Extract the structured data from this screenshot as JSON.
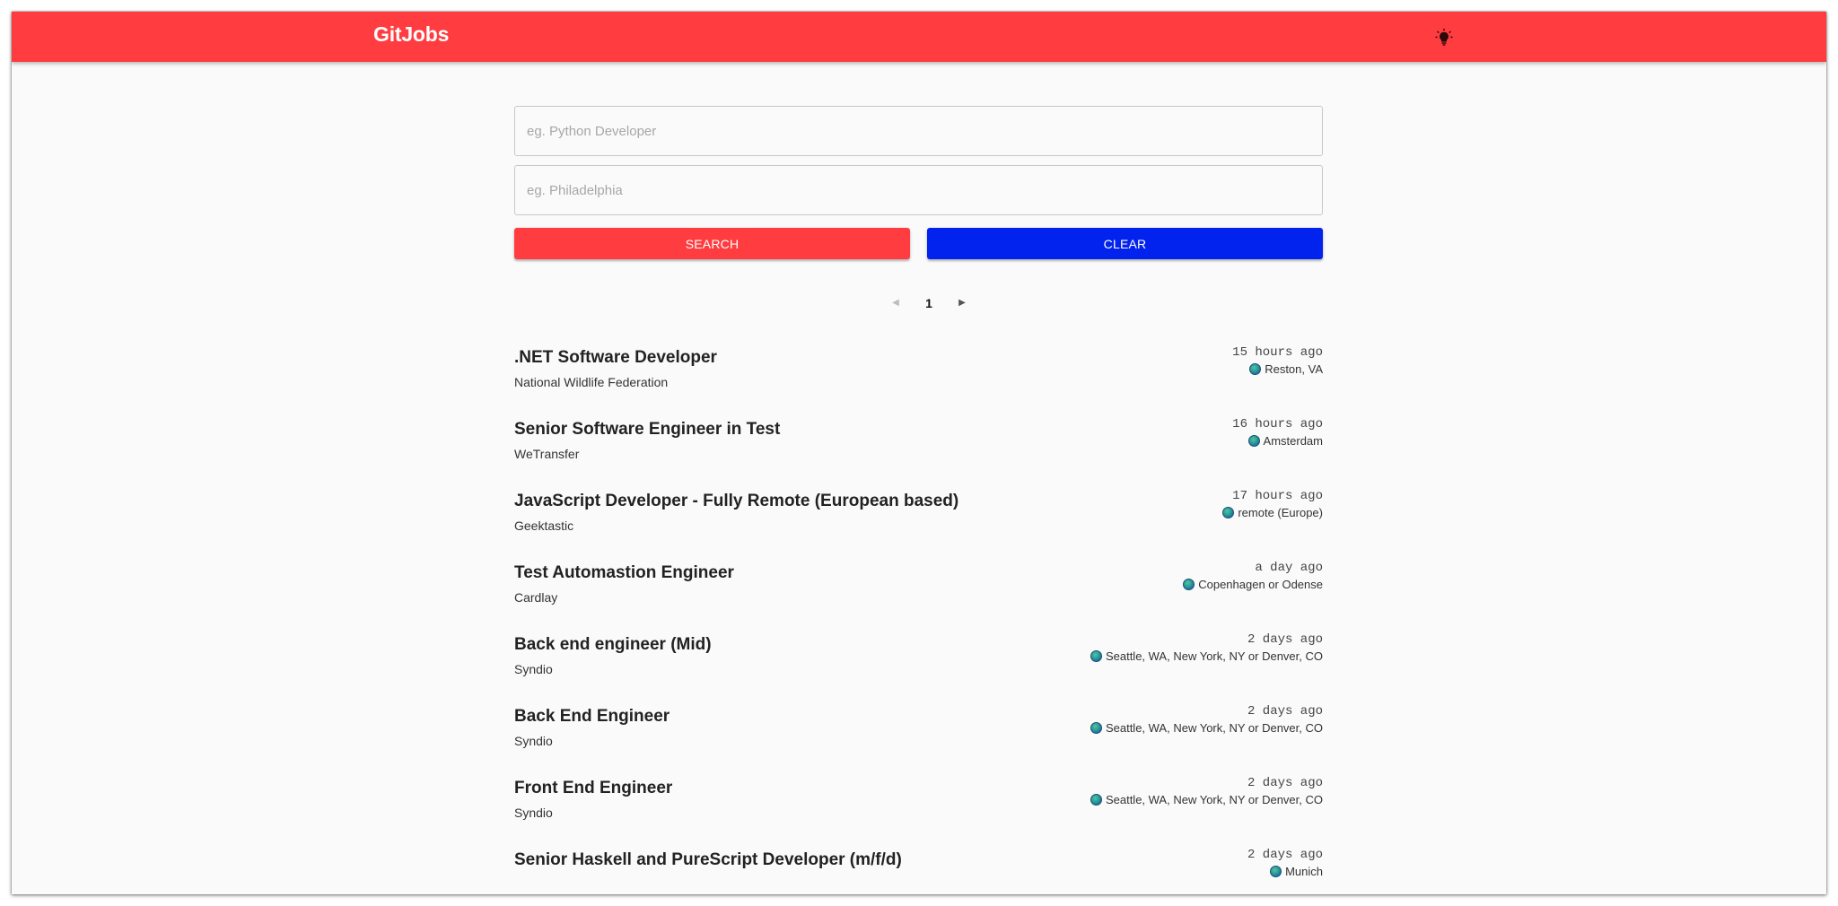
{
  "header": {
    "brand": "GitJobs",
    "theme_icon": "lightbulb-icon"
  },
  "search": {
    "description_placeholder": "eg. Python Developer",
    "location_placeholder": "eg. Philadelphia",
    "search_label": "SEARCH",
    "clear_label": "CLEAR"
  },
  "pagination": {
    "current_page": "1"
  },
  "jobs": [
    {
      "title": ".NET Software Developer",
      "company": "National Wildlife Federation",
      "time": "15 hours ago",
      "location": "Reston, VA"
    },
    {
      "title": "Senior Software Engineer in Test",
      "company": "WeTransfer",
      "time": "16 hours ago",
      "location": "Amsterdam"
    },
    {
      "title": "JavaScript Developer - Fully Remote (European based)",
      "company": "Geektastic",
      "time": "17 hours ago",
      "location": "remote (Europe)"
    },
    {
      "title": "Test Automastion Engineer",
      "company": "Cardlay",
      "time": "a day ago",
      "location": "Copenhagen or Odense"
    },
    {
      "title": "Back end engineer (Mid)",
      "company": "Syndio",
      "time": "2 days ago",
      "location": "Seattle, WA, New York, NY or Denver, CO"
    },
    {
      "title": "Back End Engineer",
      "company": "Syndio",
      "time": "2 days ago",
      "location": "Seattle, WA, New York, NY or Denver, CO"
    },
    {
      "title": "Front End Engineer",
      "company": "Syndio",
      "time": "2 days ago",
      "location": "Seattle, WA, New York, NY or Denver, CO"
    },
    {
      "title": "Senior Haskell and PureScript Developer (m/f/d)",
      "company": "",
      "time": "2 days ago",
      "location": "Munich"
    }
  ],
  "colors": {
    "brand_red": "#ff3c3f",
    "clear_blue": "#0222ee",
    "background": "#fafafa"
  }
}
